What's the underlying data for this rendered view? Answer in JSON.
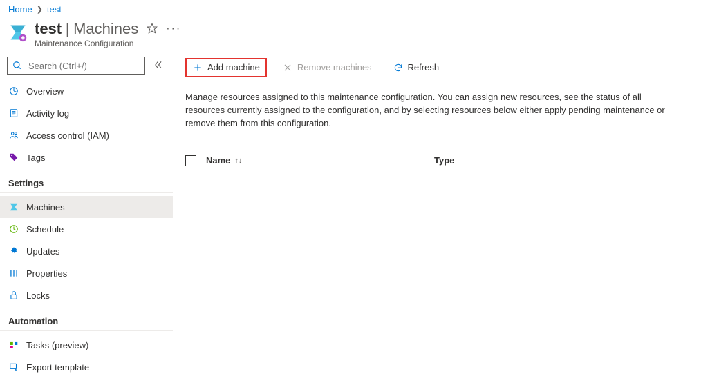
{
  "breadcrumb": {
    "home": "Home",
    "current": "test"
  },
  "header": {
    "name": "test",
    "section": "Machines",
    "subtitle": "Maintenance Configuration"
  },
  "search": {
    "placeholder": "Search (Ctrl+/)"
  },
  "nav": {
    "top": {
      "overview": "Overview",
      "activity": "Activity log",
      "iam": "Access control (IAM)",
      "tags": "Tags"
    },
    "settings_title": "Settings",
    "settings": {
      "machines": "Machines",
      "schedule": "Schedule",
      "updates": "Updates",
      "properties": "Properties",
      "locks": "Locks"
    },
    "automation_title": "Automation",
    "automation": {
      "tasks": "Tasks (preview)",
      "export": "Export template"
    }
  },
  "toolbar": {
    "add": "Add machine",
    "remove": "Remove machines",
    "refresh": "Refresh"
  },
  "description": "Manage resources assigned to this maintenance configuration. You can assign new resources, see the status of all resources currently assigned to the configuration, and by selecting resources below either apply pending maintenance or remove them from this configuration.",
  "columns": {
    "name": "Name",
    "type": "Type"
  }
}
